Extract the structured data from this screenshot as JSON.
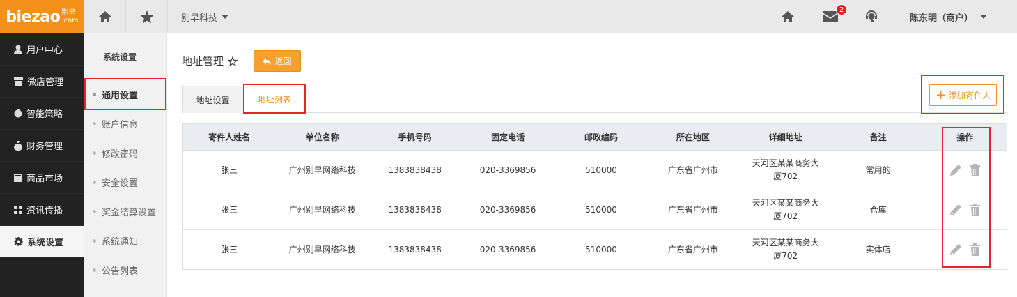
{
  "header": {
    "logo_text": "biezao",
    "logo_cn_top": "别早",
    "logo_cn_bottom": ".com",
    "company": "别早科技",
    "mail_badge": "2",
    "user": "陈东明（商户）",
    "icons": [
      "home-icon",
      "star-icon",
      "home-icon",
      "mail-icon",
      "support-icon"
    ]
  },
  "sidebar": {
    "items": [
      {
        "label": "用户中心",
        "icon": "user-icon"
      },
      {
        "label": "微店管理",
        "icon": "shop-icon"
      },
      {
        "label": "智能策略",
        "icon": "bulb-icon"
      },
      {
        "label": "财务管理",
        "icon": "money-icon"
      },
      {
        "label": "商品市场",
        "icon": "market-icon"
      },
      {
        "label": "资讯传播",
        "icon": "grid-icon"
      },
      {
        "label": "系统设置",
        "icon": "gear-icon",
        "active": true
      }
    ]
  },
  "submenu": {
    "title": "系统设置",
    "items": [
      {
        "label": "通用设置",
        "active": true
      },
      {
        "label": "账户信息"
      },
      {
        "label": "修改密码"
      },
      {
        "label": "安全设置"
      },
      {
        "label": "奖金结算设置"
      },
      {
        "label": "系统通知"
      },
      {
        "label": "公告列表"
      }
    ]
  },
  "main": {
    "title": "地址管理",
    "back_label": "返回",
    "tabs": [
      {
        "label": "地址设置"
      },
      {
        "label": "地址列表",
        "active": true
      }
    ],
    "add_label": "添加寄件人",
    "table": {
      "headers": [
        "寄件人姓名",
        "单位名称",
        "手机号码",
        "固定电话",
        "邮政编码",
        "所在地区",
        "详细地址",
        "备注",
        "操作"
      ],
      "rows": [
        {
          "name": "张三",
          "company": "广州别早网络科技",
          "mobile": "1383838438",
          "phone": "020-3369856",
          "zip": "510000",
          "region": "广东省广州市",
          "addr1": "天河区某某商务大",
          "addr2": "厦702",
          "note": "常用的"
        },
        {
          "name": "张三",
          "company": "广州别早网络科技",
          "mobile": "1383838438",
          "phone": "020-3369856",
          "zip": "510000",
          "region": "广东省广州市",
          "addr1": "天河区某某商务大",
          "addr2": "厦702",
          "note": "仓库"
        },
        {
          "name": "张三",
          "company": "广州别早网络科技",
          "mobile": "1383838438",
          "phone": "020-3369856",
          "zip": "510000",
          "region": "广东省广州市",
          "addr1": "天河区某某商务大",
          "addr2": "厦702",
          "note": "实体店"
        }
      ]
    }
  },
  "colors": {
    "accent": "#f39019",
    "highlight_box": "#e5252a",
    "sidebar_bg": "#222222"
  }
}
